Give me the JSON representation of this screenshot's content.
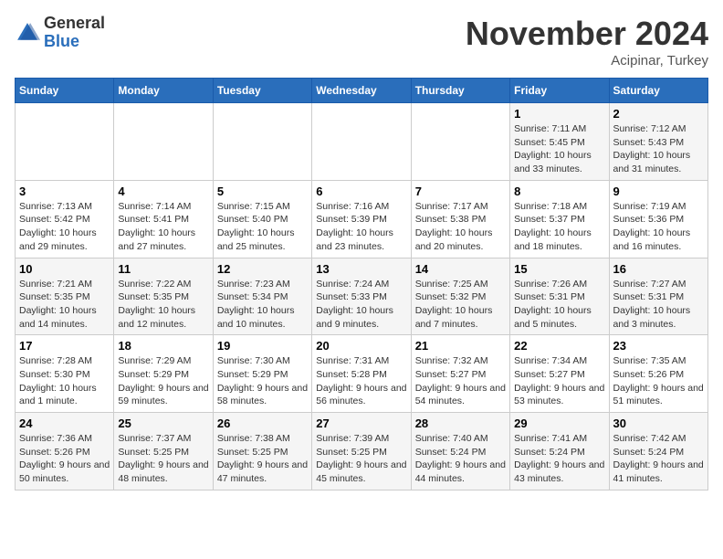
{
  "header": {
    "logo_general": "General",
    "logo_blue": "Blue",
    "month_title": "November 2024",
    "location": "Acipinar, Turkey"
  },
  "days_of_week": [
    "Sunday",
    "Monday",
    "Tuesday",
    "Wednesday",
    "Thursday",
    "Friday",
    "Saturday"
  ],
  "weeks": [
    [
      {
        "day": "",
        "info": ""
      },
      {
        "day": "",
        "info": ""
      },
      {
        "day": "",
        "info": ""
      },
      {
        "day": "",
        "info": ""
      },
      {
        "day": "",
        "info": ""
      },
      {
        "day": "1",
        "info": "Sunrise: 7:11 AM\nSunset: 5:45 PM\nDaylight: 10 hours and 33 minutes."
      },
      {
        "day": "2",
        "info": "Sunrise: 7:12 AM\nSunset: 5:43 PM\nDaylight: 10 hours and 31 minutes."
      }
    ],
    [
      {
        "day": "3",
        "info": "Sunrise: 7:13 AM\nSunset: 5:42 PM\nDaylight: 10 hours and 29 minutes."
      },
      {
        "day": "4",
        "info": "Sunrise: 7:14 AM\nSunset: 5:41 PM\nDaylight: 10 hours and 27 minutes."
      },
      {
        "day": "5",
        "info": "Sunrise: 7:15 AM\nSunset: 5:40 PM\nDaylight: 10 hours and 25 minutes."
      },
      {
        "day": "6",
        "info": "Sunrise: 7:16 AM\nSunset: 5:39 PM\nDaylight: 10 hours and 23 minutes."
      },
      {
        "day": "7",
        "info": "Sunrise: 7:17 AM\nSunset: 5:38 PM\nDaylight: 10 hours and 20 minutes."
      },
      {
        "day": "8",
        "info": "Sunrise: 7:18 AM\nSunset: 5:37 PM\nDaylight: 10 hours and 18 minutes."
      },
      {
        "day": "9",
        "info": "Sunrise: 7:19 AM\nSunset: 5:36 PM\nDaylight: 10 hours and 16 minutes."
      }
    ],
    [
      {
        "day": "10",
        "info": "Sunrise: 7:21 AM\nSunset: 5:35 PM\nDaylight: 10 hours and 14 minutes."
      },
      {
        "day": "11",
        "info": "Sunrise: 7:22 AM\nSunset: 5:35 PM\nDaylight: 10 hours and 12 minutes."
      },
      {
        "day": "12",
        "info": "Sunrise: 7:23 AM\nSunset: 5:34 PM\nDaylight: 10 hours and 10 minutes."
      },
      {
        "day": "13",
        "info": "Sunrise: 7:24 AM\nSunset: 5:33 PM\nDaylight: 10 hours and 9 minutes."
      },
      {
        "day": "14",
        "info": "Sunrise: 7:25 AM\nSunset: 5:32 PM\nDaylight: 10 hours and 7 minutes."
      },
      {
        "day": "15",
        "info": "Sunrise: 7:26 AM\nSunset: 5:31 PM\nDaylight: 10 hours and 5 minutes."
      },
      {
        "day": "16",
        "info": "Sunrise: 7:27 AM\nSunset: 5:31 PM\nDaylight: 10 hours and 3 minutes."
      }
    ],
    [
      {
        "day": "17",
        "info": "Sunrise: 7:28 AM\nSunset: 5:30 PM\nDaylight: 10 hours and 1 minute."
      },
      {
        "day": "18",
        "info": "Sunrise: 7:29 AM\nSunset: 5:29 PM\nDaylight: 9 hours and 59 minutes."
      },
      {
        "day": "19",
        "info": "Sunrise: 7:30 AM\nSunset: 5:29 PM\nDaylight: 9 hours and 58 minutes."
      },
      {
        "day": "20",
        "info": "Sunrise: 7:31 AM\nSunset: 5:28 PM\nDaylight: 9 hours and 56 minutes."
      },
      {
        "day": "21",
        "info": "Sunrise: 7:32 AM\nSunset: 5:27 PM\nDaylight: 9 hours and 54 minutes."
      },
      {
        "day": "22",
        "info": "Sunrise: 7:34 AM\nSunset: 5:27 PM\nDaylight: 9 hours and 53 minutes."
      },
      {
        "day": "23",
        "info": "Sunrise: 7:35 AM\nSunset: 5:26 PM\nDaylight: 9 hours and 51 minutes."
      }
    ],
    [
      {
        "day": "24",
        "info": "Sunrise: 7:36 AM\nSunset: 5:26 PM\nDaylight: 9 hours and 50 minutes."
      },
      {
        "day": "25",
        "info": "Sunrise: 7:37 AM\nSunset: 5:25 PM\nDaylight: 9 hours and 48 minutes."
      },
      {
        "day": "26",
        "info": "Sunrise: 7:38 AM\nSunset: 5:25 PM\nDaylight: 9 hours and 47 minutes."
      },
      {
        "day": "27",
        "info": "Sunrise: 7:39 AM\nSunset: 5:25 PM\nDaylight: 9 hours and 45 minutes."
      },
      {
        "day": "28",
        "info": "Sunrise: 7:40 AM\nSunset: 5:24 PM\nDaylight: 9 hours and 44 minutes."
      },
      {
        "day": "29",
        "info": "Sunrise: 7:41 AM\nSunset: 5:24 PM\nDaylight: 9 hours and 43 minutes."
      },
      {
        "day": "30",
        "info": "Sunrise: 7:42 AM\nSunset: 5:24 PM\nDaylight: 9 hours and 41 minutes."
      }
    ]
  ]
}
